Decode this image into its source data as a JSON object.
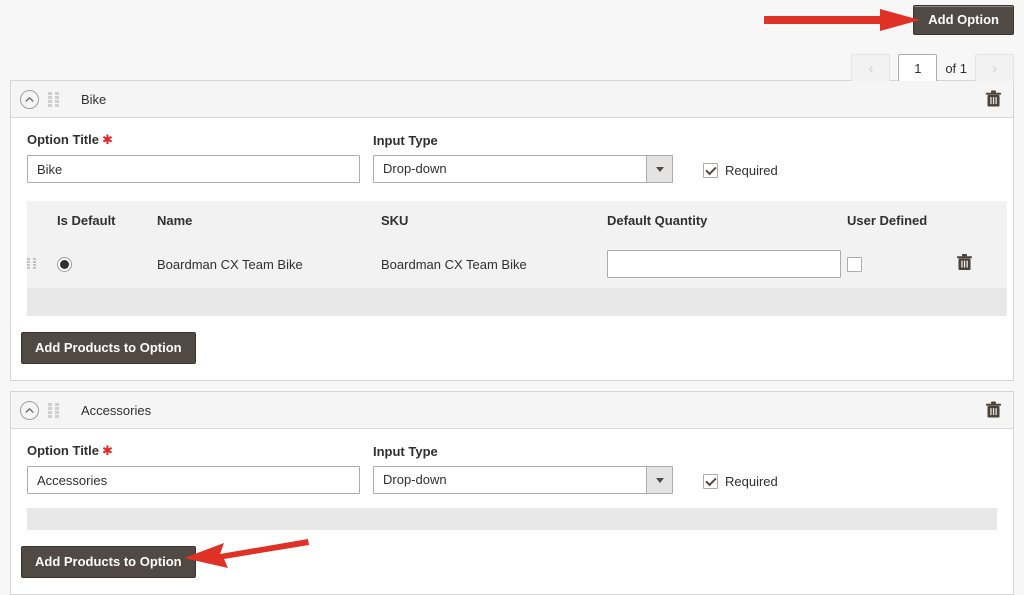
{
  "toolbar": {
    "add_option_label": "Add Option"
  },
  "pagination": {
    "prev_icon": "chevron-left-icon",
    "next_icon": "chevron-right-icon",
    "current_page": "1",
    "of_label": "of 1"
  },
  "colors": {
    "button_dark": "#514943",
    "arrow_red": "#e03127",
    "required_star": "#e22626",
    "page_background": "#f7f7f7",
    "panel_header": "#f5f5f5",
    "table_row": "#f2f2f2"
  },
  "icons": {
    "collapse": "chevron-up-circle-icon",
    "drag_handle": "drag-handle-icon",
    "delete": "trash-icon",
    "select_caret": "chevron-down-icon"
  },
  "options": [
    {
      "header_title": "Bike",
      "option_title_label": "Option Title",
      "option_title_value": "Bike",
      "input_type_label": "Input Type",
      "input_type_value": "Drop-down",
      "required_label": "Required",
      "required_checked": true,
      "has_table": true,
      "table": {
        "columns": [
          "Is Default",
          "Name",
          "SKU",
          "Default Quantity",
          "User Defined"
        ],
        "rows": [
          {
            "is_default": true,
            "name": "Boardman CX Team Bike",
            "sku": "Boardman CX Team Bike",
            "default_quantity": "",
            "default_quantity_placeholder": "",
            "user_defined": false
          }
        ]
      },
      "add_products_label": "Add Products to Option"
    },
    {
      "header_title": "Accessories",
      "option_title_label": "Option Title",
      "option_title_value": "Accessories",
      "input_type_label": "Input Type",
      "input_type_value": "Drop-down",
      "required_label": "Required",
      "required_checked": true,
      "has_table": false,
      "add_products_label": "Add Products to Option"
    }
  ]
}
